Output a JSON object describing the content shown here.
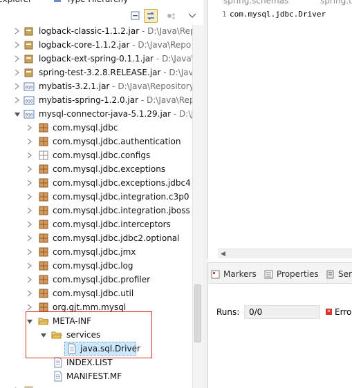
{
  "explorer": {
    "tabs": [
      {
        "label": "Explorer"
      },
      {
        "label": "Type Hierarchy"
      }
    ],
    "toolbar": [
      {
        "name": "collapse-all"
      },
      {
        "name": "link-with-editor",
        "active": true
      },
      {
        "name": "view-menu"
      }
    ],
    "tree": [
      {
        "label": "logback-classic-1.1.2.jar",
        "path": " - D:\\Java\\Rep"
      },
      {
        "label": "logback-core-1.1.2.jar",
        "path": " - D:\\Java\\Repo"
      },
      {
        "label": "logback-ext-spring-0.1.1.jar",
        "path": " - D:\\Java\\"
      },
      {
        "label": "spring-test-3.2.8.RELEASE.jar",
        "path": " - D:\\Java"
      },
      {
        "label": "mybatis-3.2.1.jar",
        "path": " - D:\\Java\\Repository"
      },
      {
        "label": "mybatis-spring-1.2.0.jar",
        "path": " - D:\\Java\\Repo"
      },
      {
        "label": "mysql-connector-java-5.1.29.jar",
        "path": " - D:\\Ja"
      },
      {
        "label": "com.mysql.jdbc"
      },
      {
        "label": "com.mysql.jdbc.authentication"
      },
      {
        "label": "com.mysql.jdbc.configs"
      },
      {
        "label": "com.mysql.jdbc.exceptions"
      },
      {
        "label": "com.mysql.jdbc.exceptions.jdbc4"
      },
      {
        "label": "com.mysql.jdbc.integration.c3p0"
      },
      {
        "label": "com.mysql.jdbc.integration.jboss"
      },
      {
        "label": "com.mysql.jdbc.interceptors"
      },
      {
        "label": "com.mysql.jdbc.jdbc2.optional"
      },
      {
        "label": "com.mysql.jdbc.jmx"
      },
      {
        "label": "com.mysql.jdbc.log"
      },
      {
        "label": "com.mysql.jdbc.profiler"
      },
      {
        "label": "com.mysql.jdbc.util"
      },
      {
        "label": "org.gjt.mm.mysql"
      },
      {
        "label": "META-INF"
      },
      {
        "label": "services"
      },
      {
        "label": "java.sql.Driver"
      },
      {
        "label": "INDEX.LIST"
      },
      {
        "label": "MANIFEST.MF"
      }
    ]
  },
  "editor": {
    "tabs": [
      {
        "label": "spring.schemas"
      },
      {
        "label": "spring.t"
      }
    ],
    "line_number": "1",
    "code": "com.mysql.jdbc.Driver"
  },
  "views": {
    "tabs": [
      {
        "label": "Markers"
      },
      {
        "label": "Properties"
      },
      {
        "label": "Ser"
      }
    ],
    "runs_label": "Runs:",
    "runs_value": "0/0",
    "errors_label": "Erro"
  },
  "colors": {
    "highlight_border": "#d9362f",
    "selection_bg": "#cce8ff",
    "jar_icon": "#c8a45a",
    "package_icon": "#b0703a",
    "folder_icon": "#e8c15a"
  }
}
